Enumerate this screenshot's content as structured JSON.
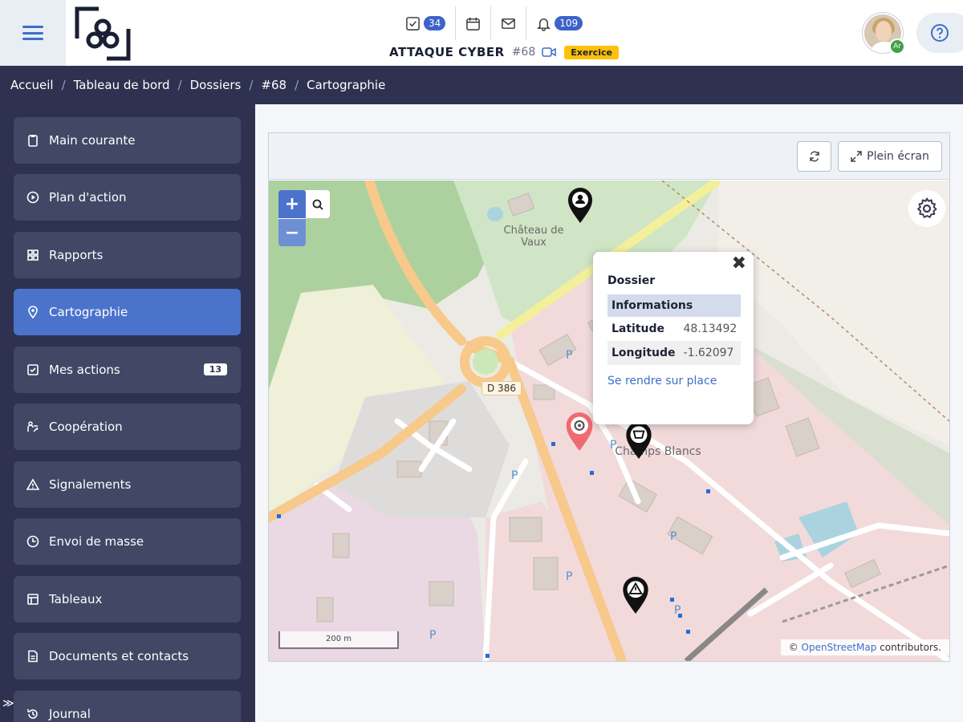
{
  "header": {
    "badges": {
      "tasks": "34",
      "notifications": "109"
    },
    "title": "ATTAQUE CYBER",
    "number": "#68",
    "tag": "Exercice",
    "status_initial": "Ar"
  },
  "breadcrumb": [
    "Accueil",
    "Tableau de bord",
    "Dossiers",
    "#68",
    "Cartographie"
  ],
  "sidebar": {
    "items": [
      {
        "label": "Main courante",
        "icon": "clipboard-icon"
      },
      {
        "label": "Plan d'action",
        "icon": "play-circle-icon"
      },
      {
        "label": "Rapports",
        "icon": "grid-icon"
      },
      {
        "label": "Cartographie",
        "icon": "location-pin-icon",
        "active": true
      },
      {
        "label": "Mes actions",
        "icon": "checkbox-icon",
        "count": "13"
      },
      {
        "label": "Coopération",
        "icon": "cooperation-icon"
      },
      {
        "label": "Signalements",
        "icon": "warning-icon"
      },
      {
        "label": "Envoi de masse",
        "icon": "clock-icon"
      },
      {
        "label": "Tableaux",
        "icon": "table-icon"
      },
      {
        "label": "Documents et contacts",
        "icon": "document-icon"
      },
      {
        "label": "Journal",
        "icon": "history-icon"
      }
    ]
  },
  "map_toolbar": {
    "fullscreen_label": "Plein écran"
  },
  "map": {
    "zoom_in": "+",
    "zoom_out": "−",
    "labels": {
      "chateau": "Château de Vaux",
      "champs": "Champs Blancs",
      "road": "D 386"
    },
    "scale": "200 m",
    "attribution_prefix": "©",
    "attribution_link": "OpenStreetMap",
    "attribution_suffix": "contributors."
  },
  "popup": {
    "title": "Dossier",
    "section": "Informations",
    "rows": [
      {
        "key": "Latitude",
        "value": "48.13492"
      },
      {
        "key": "Longitude",
        "value": "-1.62097"
      }
    ],
    "link": "Se rendre sur place"
  },
  "colors": {
    "accent": "#4c73cc",
    "sidebar": "#2e3250",
    "badge": "#3d63c9",
    "tag": "#ffc107"
  }
}
